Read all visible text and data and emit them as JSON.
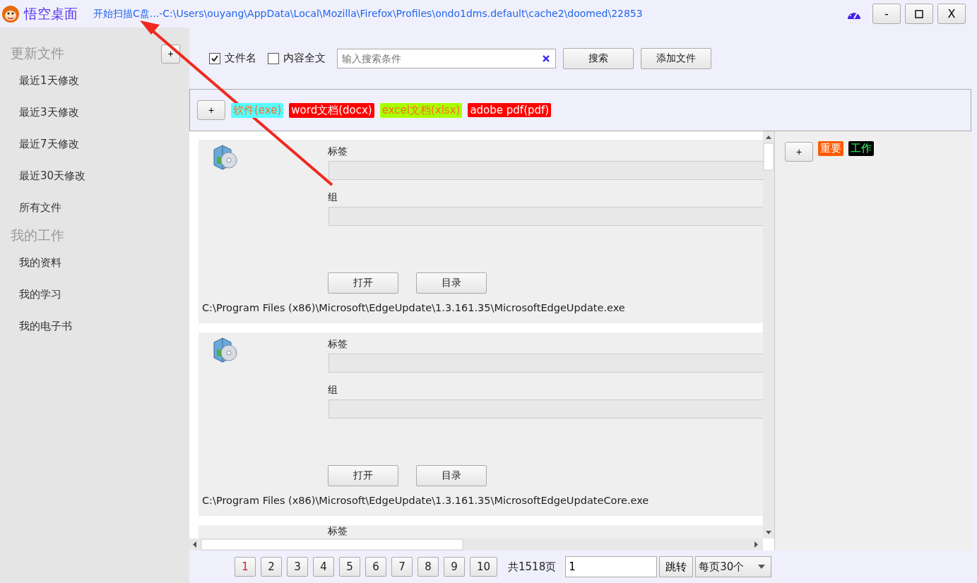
{
  "app": {
    "name": "悟空桌面",
    "status": "开始扫描C盘...-C:\\Users\\ouyang\\AppData\\Local\\Mozilla\\Firefox\\Profiles\\ondo1dms.default\\cache2\\doomed\\22853"
  },
  "window_buttons": [
    {
      "kind": "text",
      "label": "-"
    },
    {
      "kind": "maximize"
    },
    {
      "kind": "text",
      "label": "X"
    }
  ],
  "sidebar": {
    "sections": [
      {
        "title": "更新文件",
        "add": "+",
        "items": [
          "最近1天修改",
          "最近3天修改",
          "最近7天修改",
          "最近30天修改",
          "所有文件"
        ]
      },
      {
        "title": "我的工作",
        "items": [
          "我的资料",
          "我的学习",
          "我的电子书"
        ]
      }
    ]
  },
  "search": {
    "filters": [
      {
        "label": "文件名",
        "checked": true
      },
      {
        "label": "内容全文",
        "checked": false
      }
    ],
    "placeholder": "输入搜索条件",
    "buttons": [
      "搜索",
      "添加文件"
    ]
  },
  "type_tags": {
    "add": "+",
    "items": [
      {
        "label": "软件(exe)",
        "color": "#55ffff",
        "kind": "warm"
      },
      {
        "label": "word文档(docx)",
        "color": "#ff0000",
        "kind": "white"
      },
      {
        "label": "excel文档(xlsx)",
        "color": "#aaff00",
        "kind": "warm"
      },
      {
        "label": "adobe pdf(pdf)",
        "color": "#ff0000",
        "kind": "white"
      }
    ]
  },
  "files": [
    {
      "kind": "full",
      "tag_label": "标签",
      "group_label": "组",
      "buttons": [
        "打开",
        "目录"
      ],
      "path": "C:\\Program Files (x86)\\Microsoft\\EdgeUpdate\\1.3.161.35\\MicrosoftEdgeUpdate.exe"
    },
    {
      "kind": "full",
      "tag_label": "标签",
      "group_label": "组",
      "buttons": [
        "打开",
        "目录"
      ],
      "path": "C:\\Program Files (x86)\\Microsoft\\EdgeUpdate\\1.3.161.35\\MicrosoftEdgeUpdateCore.exe"
    },
    {
      "kind": "partial",
      "tag_label": "标签"
    }
  ],
  "label_tags": {
    "add": "+",
    "items": [
      {
        "label": "重要",
        "color": "#ff5a00",
        "kind": "white"
      },
      {
        "label": "工作",
        "color": "#000000",
        "kind": "green"
      }
    ]
  },
  "pagination": {
    "pages": [
      {
        "label": "1",
        "selected": true
      },
      {
        "label": "2",
        "selected": false
      },
      {
        "label": "3",
        "selected": false
      },
      {
        "label": "4",
        "selected": false
      },
      {
        "label": "5",
        "selected": false
      },
      {
        "label": "6",
        "selected": false
      },
      {
        "label": "7",
        "selected": false
      },
      {
        "label": "8",
        "selected": false
      },
      {
        "label": "9",
        "selected": false
      },
      {
        "label": "10",
        "selected": false
      }
    ],
    "total": "共1518页",
    "page_value": "1",
    "jump": "跳转",
    "per_page": "每页30个"
  }
}
